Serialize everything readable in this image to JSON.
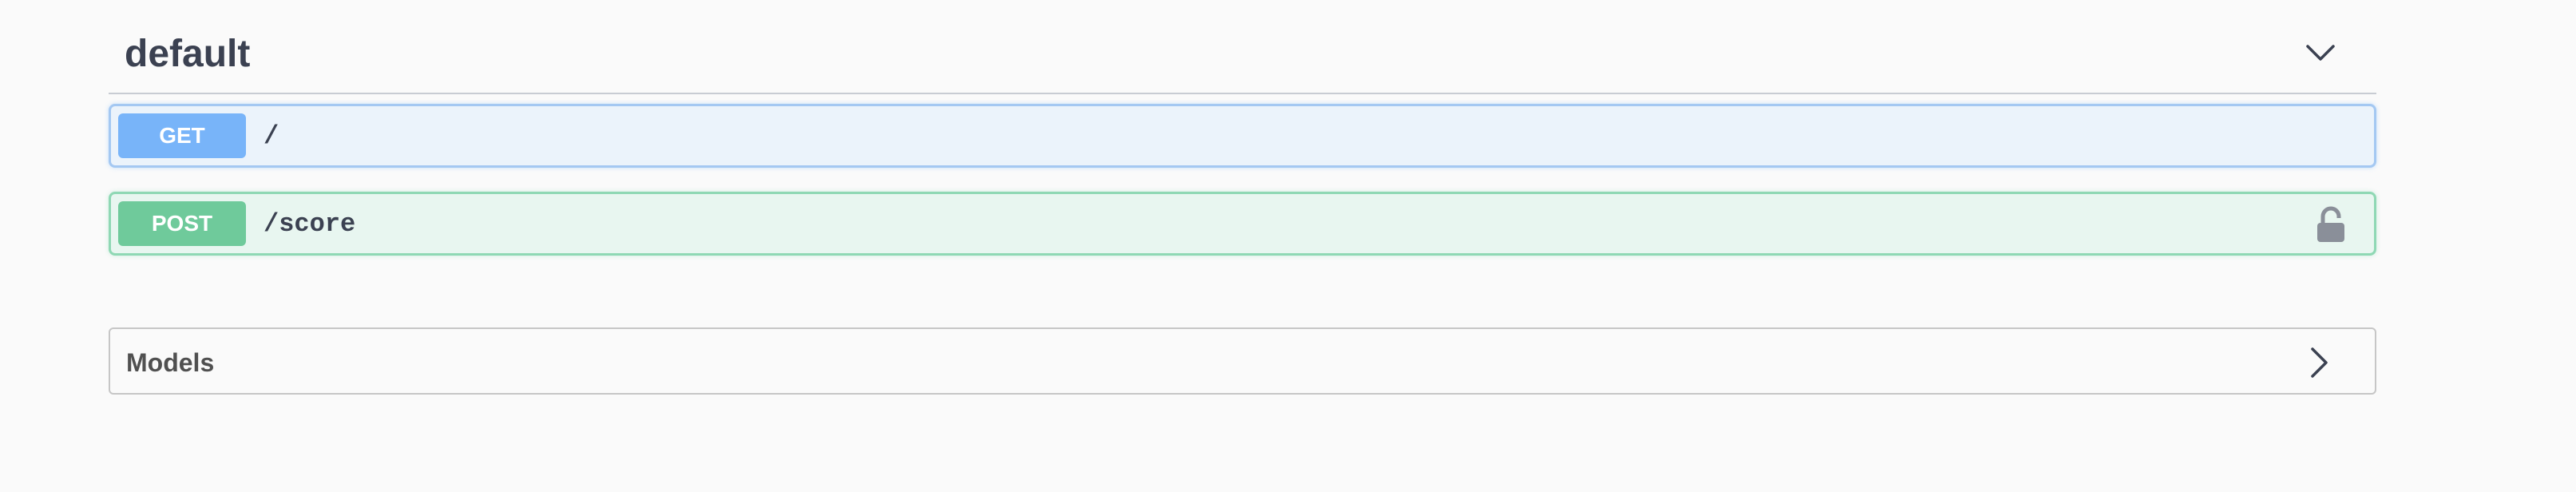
{
  "tag": {
    "title": "default",
    "toggle_icon": "chevron-down-icon"
  },
  "operations": [
    {
      "method": "GET",
      "path": "/",
      "method_color": "#78b4f9",
      "locked": false
    },
    {
      "method": "POST",
      "path": "/score",
      "method_color": "#6fca9b",
      "locked": true,
      "lock_icon": "lock-icon"
    }
  ],
  "models": {
    "title": "Models",
    "toggle_icon": "chevron-right-icon"
  },
  "colors": {
    "background": "#fafafa",
    "text": "#3b4151",
    "get_bg": "#ebf3fb",
    "get_border": "#a4c8f2",
    "post_bg": "#e8f6f0",
    "post_border": "#8fd8b4"
  }
}
